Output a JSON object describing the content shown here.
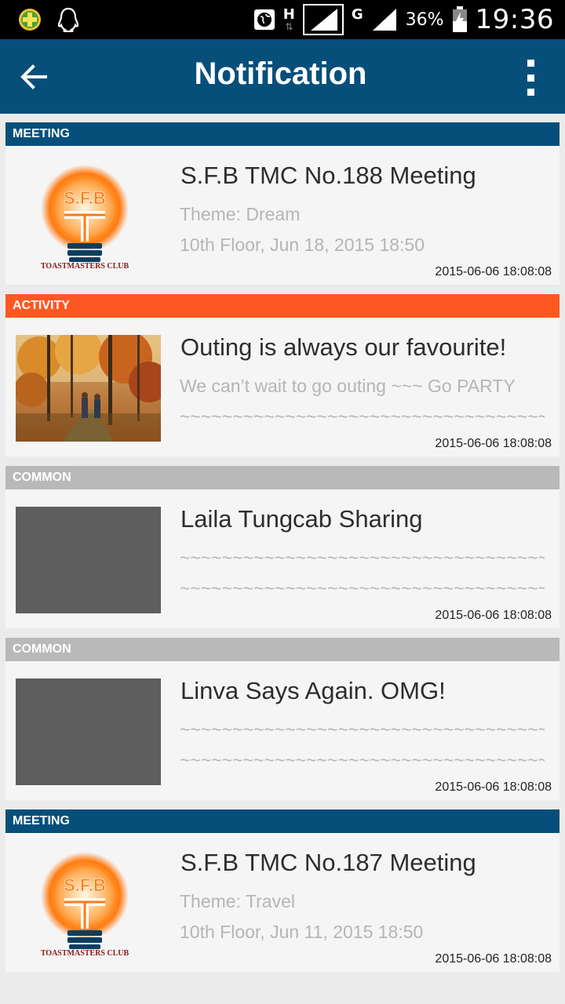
{
  "status_bar": {
    "network_h": "H",
    "network_g": "G",
    "battery": "36%",
    "time": "19:36",
    "icons": [
      "app-plus-icon",
      "qq-penguin-icon",
      "globe-icon",
      "signal-icon",
      "signal-icon",
      "battery-charging-icon"
    ]
  },
  "app_bar": {
    "title": "Notification",
    "back_icon": "arrow-left-icon",
    "menu_icon": "overflow-menu-icon",
    "color": "#064f7a"
  },
  "category_colors": {
    "MEETING": "#064f7a",
    "ACTIVITY": "#ff5722",
    "COMMON": "#b9b9b9"
  },
  "items": [
    {
      "category": "MEETING",
      "image": "sfb-toastmasters-logo",
      "logo_text": "S.F.B",
      "logo_caption": "TOASTMASTERS CLUB",
      "title": "S.F.B TMC No.188 Meeting",
      "line1": "Theme: Dream",
      "line2": "10th Floor, Jun 18, 2015 18:50",
      "time": "2015-06-06 18:08:08"
    },
    {
      "category": "ACTIVITY",
      "image": "autumn-forest-hiking-photo",
      "title": "Outing is always our favourite!",
      "line1": "We can’t wait to go outing ~~~ Go PARTY",
      "line2": "~~~~~~~~~~~~~~~~~~~~~~~~~~~~~~~~~~~~~~",
      "time": "2015-06-06 18:08:08"
    },
    {
      "category": "COMMON",
      "image": "placeholder-gray",
      "title": "Laila Tungcab Sharing",
      "line1": "~~~~~~~~~~~~~~~~~~~~~~~~~~~~~~~~~~~~~~",
      "line2": "~~~~~~~~~~~~~~~~~~~~~~~~~~~~~~~~~~~~~~",
      "time": "2015-06-06 18:08:08"
    },
    {
      "category": "COMMON",
      "image": "placeholder-gray",
      "title": "Linva Says Again. OMG!",
      "line1": "~~~~~~~~~~~~~~~~~~~~~~~~~~~~~~~~~~~~~~",
      "line2": "~~~~~~~~~~~~~~~~~~~~~~~~~~~~~~~~~~~~~~",
      "time": "2015-06-06 18:08:08"
    },
    {
      "category": "MEETING",
      "image": "sfb-toastmasters-logo",
      "logo_text": "S.F.B",
      "logo_caption": "TOASTMASTERS CLUB",
      "title": "S.F.B TMC No.187 Meeting",
      "line1": "Theme: Travel",
      "line2": "10th Floor, Jun 11, 2015 18:50",
      "time": "2015-06-06 18:08:08"
    }
  ]
}
